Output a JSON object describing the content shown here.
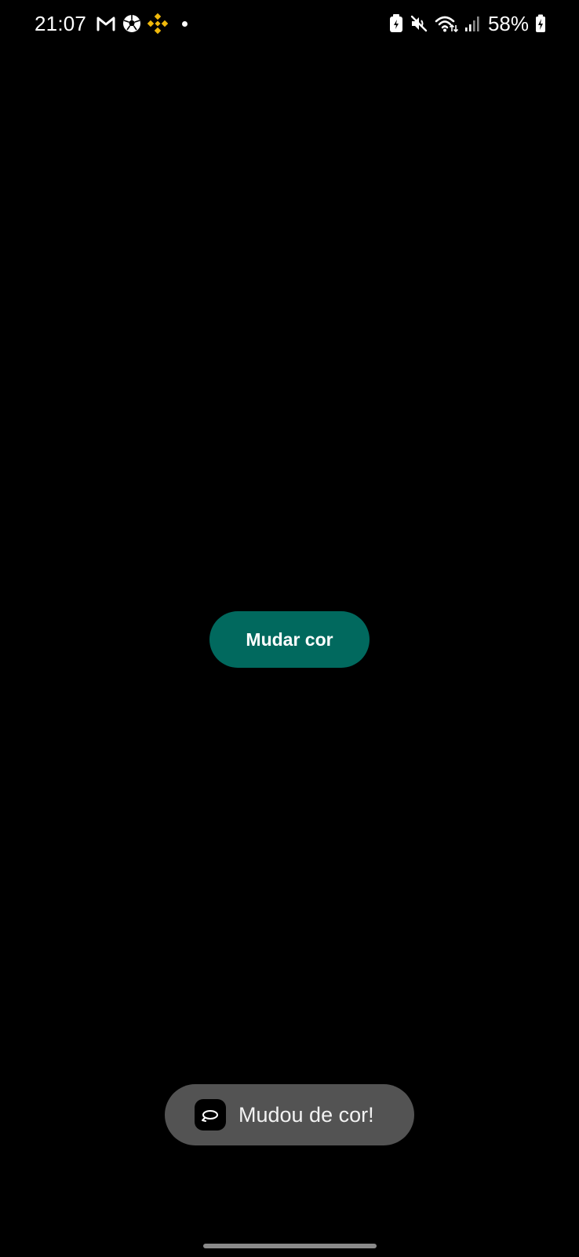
{
  "status_bar": {
    "time": "21:07",
    "battery_percent": "58%",
    "left_icons": [
      "gmail-icon",
      "soccer-ball-icon",
      "binance-icon",
      "notification-dot-icon"
    ],
    "right_icons": [
      "battery-saver-icon",
      "mute-icon",
      "wifi-icon",
      "signal-icon",
      "battery-icon"
    ]
  },
  "main": {
    "button_label": "Mudar cor",
    "button_color": "#01695e",
    "background_color": "#000000"
  },
  "toast": {
    "message": "Mudou de cor!",
    "icon": "app-rotate-icon",
    "background_color": "#535353"
  }
}
